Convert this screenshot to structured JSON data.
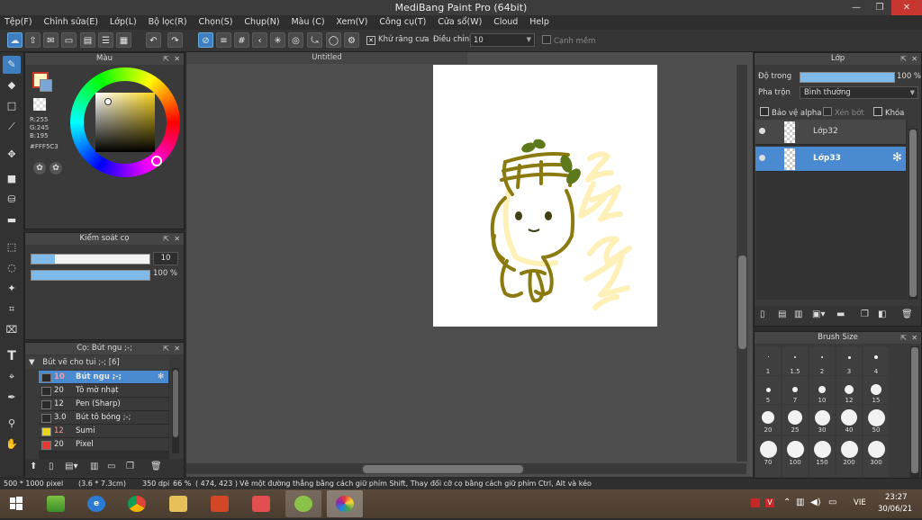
{
  "window": {
    "title": "MediBang Paint Pro (64bit)"
  },
  "menu": [
    "Tệp(F)",
    "Chỉnh sửa(E)",
    "Lớp(L)",
    "Bộ lọc(R)",
    "Chọn(S)",
    "Chụp(N)",
    "Màu (C)",
    "Xem(V)",
    "Công cụ(T)",
    "Cửa sổ(W)",
    "Cloud",
    "Help"
  ],
  "toolbar": {
    "antialias_label": "Khử răng cưa",
    "adjust_label": "Điều chỉnh",
    "adjust_value": "10",
    "edge_label": "Cạnh mềm"
  },
  "color_panel": {
    "title": "Màu",
    "r": "R:255",
    "g": "G:245",
    "b": "B:195",
    "hex": "#FFF5C3",
    "fg_color": "#fff5c3"
  },
  "brush_control": {
    "title": "Kiểm soát cọ",
    "size": "10",
    "opacity": "100 %"
  },
  "brush_panel": {
    "title": "Cọ: Bút ngu ;-;",
    "group": "Bút vẽ cho tui ;-; [6]",
    "items": [
      {
        "size": "10",
        "name": "Bút ngu ;-;",
        "color": "#2a2a2a",
        "selected": true
      },
      {
        "size": "20",
        "name": "Tô mờ nhạt",
        "color": "#2a2a2a"
      },
      {
        "size": "12",
        "name": "Pen (Sharp)",
        "color": "#2a2a2a"
      },
      {
        "size": "3.0",
        "name": "Bút tô bóng ;-;",
        "color": "#2a2a2a"
      },
      {
        "size": "12",
        "name": "Sumi",
        "color": "#e8d21d"
      },
      {
        "size": "20",
        "name": "Pixel",
        "color": "#e53935"
      }
    ]
  },
  "canvas": {
    "tab": "Untitled"
  },
  "layer_panel": {
    "title": "Lớp",
    "opacity_label": "Độ trong",
    "opacity_value": "100 %",
    "blend_label": "Pha trộn",
    "blend_value": "Bình thường",
    "protect_alpha": "Bảo vệ alpha",
    "clipping": "Xén bớt",
    "lock": "Khóa",
    "layers": [
      {
        "name": "Lớp32",
        "selected": false
      },
      {
        "name": "Lớp33",
        "selected": true
      }
    ]
  },
  "brush_size_panel": {
    "title": "Brush Size",
    "rows": [
      [
        "1",
        "1.5",
        "2",
        "3",
        "4"
      ],
      [
        "5",
        "7",
        "10",
        "12",
        "15"
      ],
      [
        "20",
        "25",
        "30",
        "40",
        "50"
      ],
      [
        "70",
        "100",
        "150",
        "200",
        "300"
      ]
    ]
  },
  "statusbar": {
    "size": "500 * 1000 pixel",
    "cm": "(3.6 * 7.3cm)",
    "dpi": "350 dpi",
    "zoom": "66 %",
    "coords": "( 474, 423 )",
    "hint": "Vẽ một đường thẳng bằng cách giữ phím Shift, Thay đổi cỡ cọ bằng cách giữ phím Ctrl, Alt và kéo"
  },
  "taskbar": {
    "lang": "VIE",
    "time": "23:27",
    "date": "30/06/21"
  }
}
